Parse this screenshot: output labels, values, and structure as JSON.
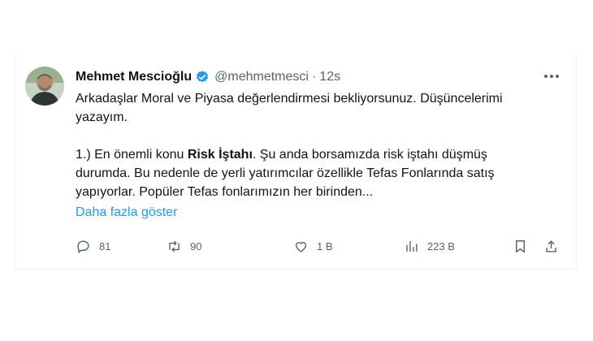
{
  "tweet": {
    "author_name": "Mehmet Mescioğlu",
    "handle": "@mehmetmesci",
    "separator": "·",
    "time": "12s",
    "line1": "Arkadaşlar Moral ve Piyasa değerlendirmesi bekliyorsunuz. Düşüncelerimi",
    "line2": "yazayım.",
    "p2_prefix": "1.) En önemli konu ",
    "p2_bold": "Risk İştahı",
    "p2_line1_rest": ". Şu anda borsamızda risk iştahı düşmüş",
    "p2_line2": "durumda. Bu nedenle de yerli yatırımcılar özellikle Tefas Fonlarında satış",
    "p2_line3": "yapıyorlar. Popüler Tefas fonlarımızın her birinden...",
    "show_more": "Daha fazla göster"
  },
  "actions": {
    "replies": "81",
    "retweets": "90",
    "likes": "1 B",
    "views": "223 B"
  },
  "icons": [
    "verified-badge-icon",
    "more-icon",
    "reply-icon",
    "retweet-icon",
    "like-icon",
    "views-icon",
    "bookmark-icon",
    "share-icon"
  ],
  "colors": {
    "accent": "#1d9bf0",
    "muted": "#536471",
    "text": "#0f1419"
  }
}
